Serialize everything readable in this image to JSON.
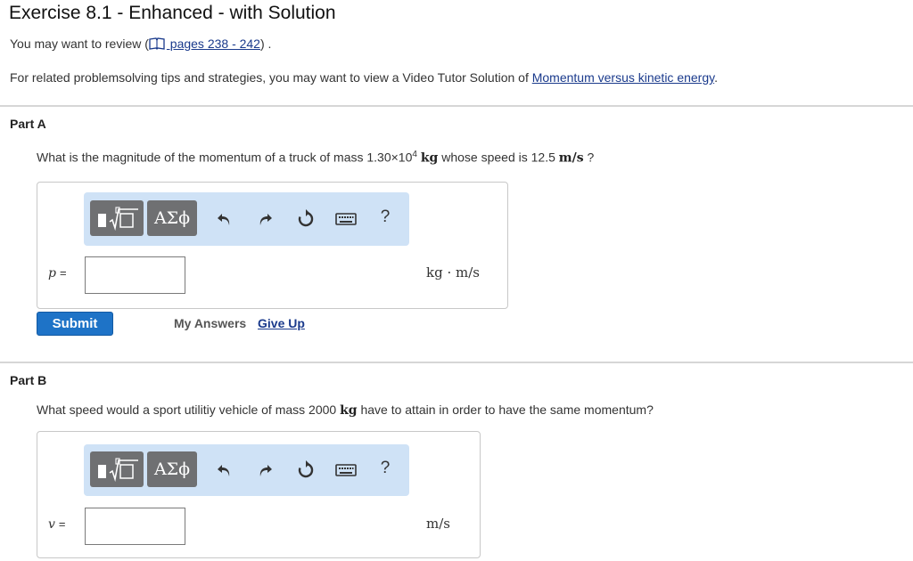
{
  "header": {
    "title": "Exercise 8.1 - Enhanced - with Solution",
    "review_prefix": "You may want to review (",
    "review_link": " pages 238 - 242",
    "review_suffix": ") .",
    "related_text": "For related problemsolving tips and strategies, you may want to view a Video Tutor Solution of ",
    "related_link": "Momentum versus kinetic energy",
    "related_suffix": "."
  },
  "partA": {
    "label": "Part A",
    "question_1": "What is the magnitude of the momentum of a truck of mass 1.30×10",
    "question_sup": "4",
    "question_unit1": "kg",
    "question_2": " whose speed is 12.5 ",
    "question_unit2": "m/s",
    "question_3": " ?",
    "variable": "p",
    "equals": "=",
    "input_value": "",
    "unit": "kg · m/s",
    "toolbar": {
      "templates_icon": "template-icon",
      "symbols_label": "ΑΣϕ",
      "help_label": "?"
    },
    "submit_label": "Submit",
    "my_answers_label": "My Answers",
    "give_up_label": "Give Up"
  },
  "partB": {
    "label": "Part B",
    "question_1": "What speed would a sport utilitiy vehicle of mass 2000 ",
    "question_unit1": "kg",
    "question_2": " have to attain in order to have the same momentum?",
    "variable": "v",
    "equals": "=",
    "input_value": "",
    "unit": "m/s",
    "toolbar": {
      "templates_icon": "template-icon",
      "symbols_label": "ΑΣϕ",
      "help_label": "?"
    }
  },
  "colors": {
    "toolbar_bg": "#cfe2f6",
    "toolbar_button": "#6f7072",
    "submit": "#1e73c7",
    "link": "#1a3a8c"
  }
}
